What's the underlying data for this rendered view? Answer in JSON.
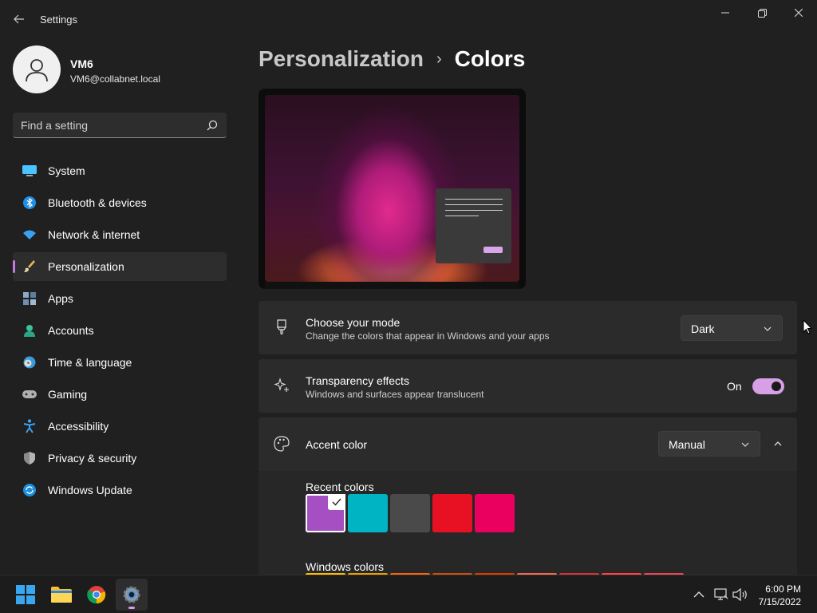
{
  "window": {
    "title": "Settings"
  },
  "user": {
    "name": "VM6",
    "email": "VM6@collabnet.local"
  },
  "search": {
    "placeholder": "Find a setting"
  },
  "sidebar": {
    "items": [
      {
        "label": "System",
        "icon": "system-icon",
        "active": false
      },
      {
        "label": "Bluetooth & devices",
        "icon": "bluetooth-icon",
        "active": false
      },
      {
        "label": "Network & internet",
        "icon": "wifi-icon",
        "active": false
      },
      {
        "label": "Personalization",
        "icon": "brush-icon",
        "active": true
      },
      {
        "label": "Apps",
        "icon": "apps-icon",
        "active": false
      },
      {
        "label": "Accounts",
        "icon": "accounts-icon",
        "active": false
      },
      {
        "label": "Time & language",
        "icon": "clock-globe-icon",
        "active": false
      },
      {
        "label": "Gaming",
        "icon": "gamepad-icon",
        "active": false
      },
      {
        "label": "Accessibility",
        "icon": "accessibility-icon",
        "active": false
      },
      {
        "label": "Privacy & security",
        "icon": "shield-icon",
        "active": false
      },
      {
        "label": "Windows Update",
        "icon": "update-icon",
        "active": false
      }
    ]
  },
  "breadcrumb": {
    "parent": "Personalization",
    "separator": "›",
    "current": "Colors"
  },
  "mode": {
    "title": "Choose your mode",
    "subtitle": "Change the colors that appear in Windows and your apps",
    "value": "Dark"
  },
  "transparency": {
    "title": "Transparency effects",
    "subtitle": "Windows and surfaces appear translucent",
    "state_label": "On",
    "enabled": true
  },
  "accent": {
    "title": "Accent color",
    "value": "Manual",
    "recent_label": "Recent colors",
    "recent_colors": [
      "#a64fc2",
      "#00b4c4",
      "#4a4a4a",
      "#e81123",
      "#ea005e"
    ],
    "selected_index": 0,
    "windows_label": "Windows colors",
    "windows_colors": [
      "#ffb900",
      "#e7a100",
      "#f7630c",
      "#ca5010",
      "#da3b01",
      "#ef6950",
      "#d13438",
      "#ff4343",
      "#e74856"
    ]
  },
  "taskbar": {
    "apps": [
      "windows-start",
      "file-explorer",
      "chrome",
      "settings"
    ],
    "time": "6:00 PM",
    "date": "7/15/2022"
  },
  "colors": {
    "accent": "#d69fe6",
    "background": "#202020",
    "card": "#2b2b2b"
  }
}
